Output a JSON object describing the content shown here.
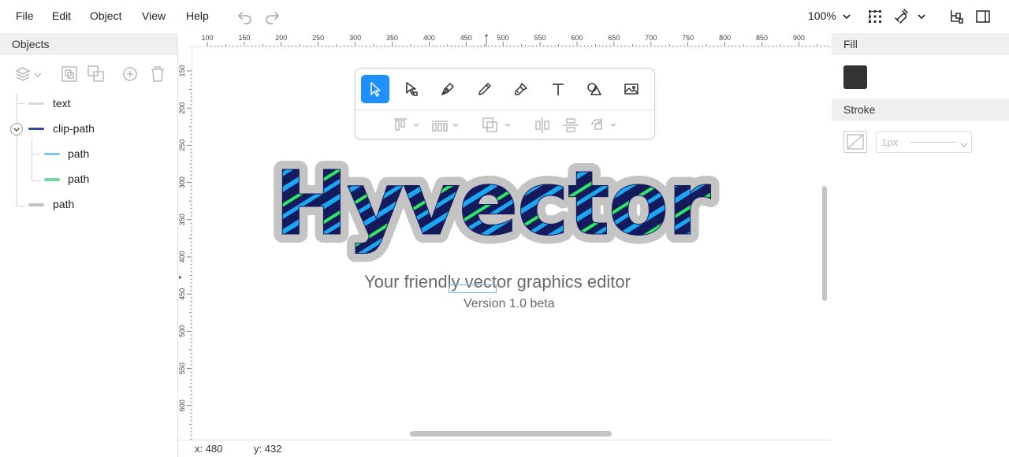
{
  "menu": {
    "items": [
      "File",
      "Edit",
      "Object",
      "View",
      "Help"
    ]
  },
  "toolbar": {
    "zoom_level": "100%"
  },
  "objects_panel": {
    "title": "Objects",
    "tree": [
      {
        "label": "text",
        "thumb_color": "#bdbdbd"
      },
      {
        "label": "clip-path",
        "thumb_color": "#1a2a6c",
        "expanded": true
      },
      {
        "label": "path",
        "thumb_color": "#2aa6f0"
      },
      {
        "label": "path",
        "thumb_color": "#30d858"
      },
      {
        "label": "path",
        "thumb_color": "#bdbdbd"
      }
    ]
  },
  "canvas": {
    "ruler_h_labels": [
      "100",
      "150",
      "200",
      "250",
      "300",
      "350",
      "400",
      "450",
      "500",
      "550",
      "600",
      "650",
      "700",
      "750",
      "800",
      "850",
      "900"
    ],
    "ruler_v_labels": [
      "150",
      "200",
      "250",
      "300",
      "350",
      "400",
      "450",
      "500",
      "550",
      "600"
    ],
    "logo_text": "Hyvector",
    "logo_colors": {
      "fill": "#141b5c",
      "blue": "#1aa8f5",
      "green": "#2ee860",
      "outline": "#c4c4c4"
    },
    "tagline": "Your friendly vector graphics editor",
    "version": "Version 1.0 beta"
  },
  "status": {
    "x": "x: 480",
    "y": "y: 432"
  },
  "properties": {
    "fill_title": "Fill",
    "fill_color": "#333333",
    "stroke_title": "Stroke",
    "stroke_width": "1px"
  },
  "colors": {
    "accent": "#1e90ff"
  }
}
